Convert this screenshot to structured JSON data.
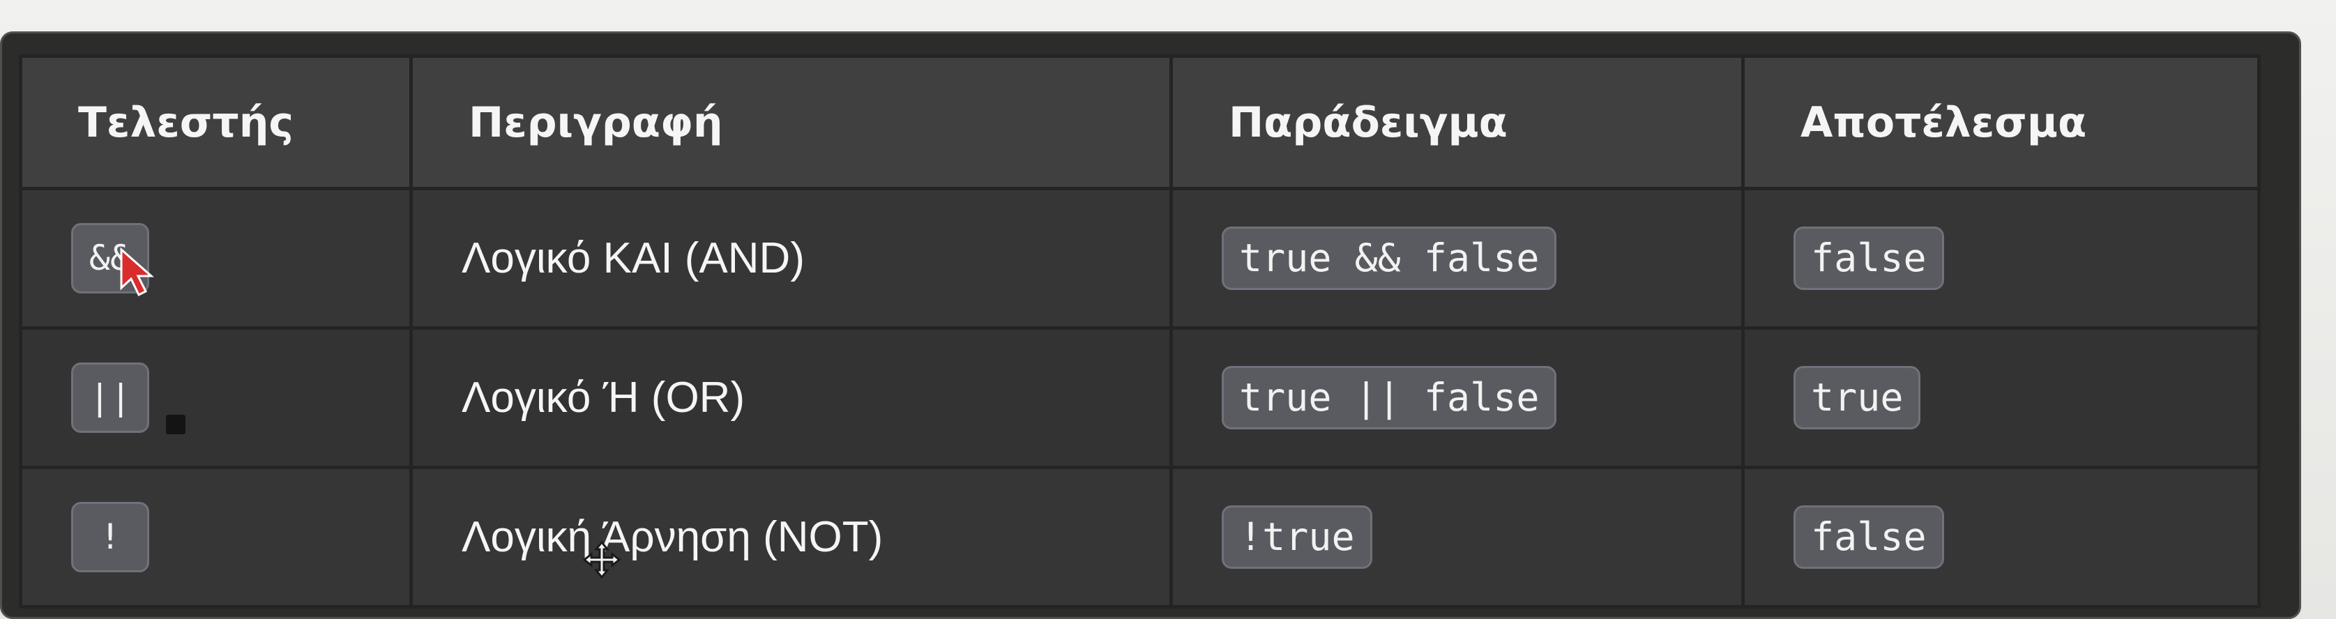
{
  "table": {
    "headers": [
      "Τελεστής",
      "Περιγραφή",
      "Παράδειγμα",
      "Αποτέλεσμα"
    ],
    "rows": [
      {
        "operator": "&&",
        "description": "Λογικό ΚΑΙ (AND)",
        "example": "true && false",
        "result": "false"
      },
      {
        "operator": "||",
        "description": "Λογικό Ή (OR)",
        "example": "true || false",
        "result": "true"
      },
      {
        "operator": "!",
        "description": "Λογική Άρνηση (NOT)",
        "example": "!true",
        "result": "false"
      }
    ]
  },
  "colors": {
    "page_background": "#e9e9e7",
    "table_background": "#373737",
    "header_background": "#404040",
    "chip_background": "#5a5b60",
    "cursor": "#d92d2d"
  },
  "icons": [
    "mouse-cursor-icon",
    "move-cursor-icon",
    "small-square-marker-icon"
  ]
}
